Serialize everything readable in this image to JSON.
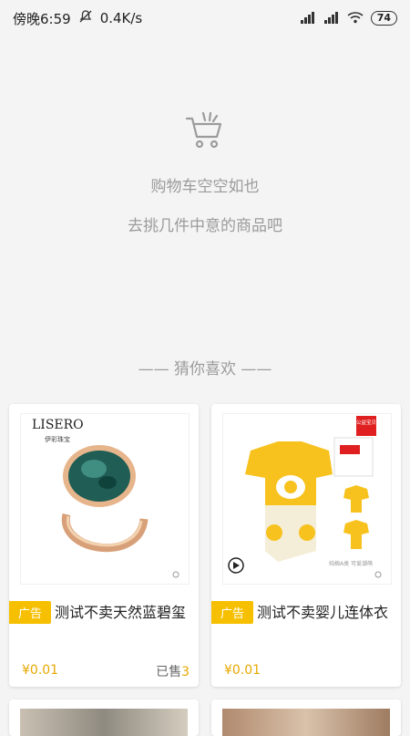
{
  "status": {
    "time": "傍晚6:59",
    "network_speed": "0.4K/s",
    "battery": "74"
  },
  "empty": {
    "message1": "购物车空空如也",
    "message2": "去挑几件中意的商品吧"
  },
  "recommend": {
    "header": "—— 猜你喜欢 ——",
    "items": [
      {
        "ad_label": "广告",
        "title": "测试不卖天然蓝碧玺",
        "price": "¥0.01",
        "sold_prefix": "已售",
        "sold_count": "3",
        "brand": "LISERO",
        "brand_sub": "伊彩珠宝"
      },
      {
        "ad_label": "广告",
        "title": "测试不卖婴儿连体衣",
        "price": "¥0.01",
        "sold_prefix": "",
        "sold_count": "",
        "tag": "公益宝贝",
        "caption": "纯棉A类 可爱潮萌"
      }
    ]
  },
  "colors": {
    "accent": "#f6c000",
    "price": "#e8a800"
  }
}
